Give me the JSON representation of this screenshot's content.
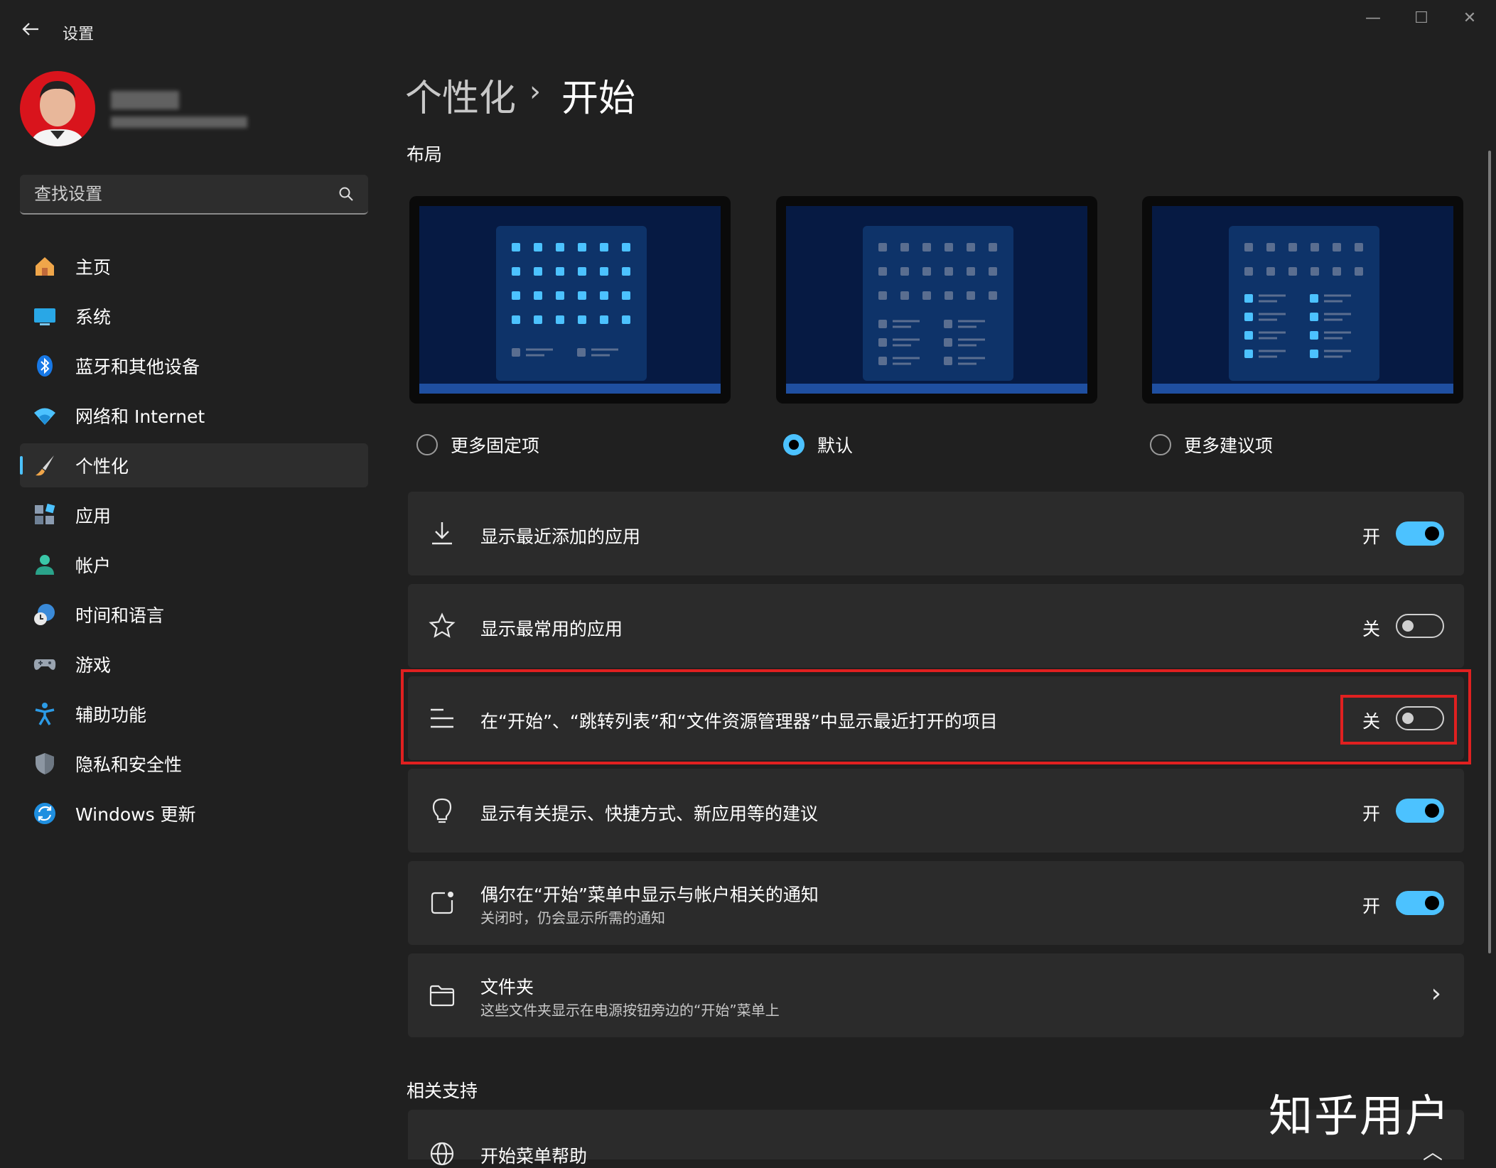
{
  "window": {
    "title": "设置",
    "controls": {
      "minimize": "—",
      "maximize": "☐",
      "close": "✕"
    }
  },
  "search": {
    "placeholder": "查找设置"
  },
  "sidebar": {
    "items": [
      {
        "label": "主页",
        "icon": "home-icon"
      },
      {
        "label": "系统",
        "icon": "system-icon"
      },
      {
        "label": "蓝牙和其他设备",
        "icon": "bluetooth-icon"
      },
      {
        "label": "网络和 Internet",
        "icon": "wifi-icon"
      },
      {
        "label": "个性化",
        "icon": "brush-icon",
        "active": true
      },
      {
        "label": "应用",
        "icon": "apps-icon"
      },
      {
        "label": "帐户",
        "icon": "account-icon"
      },
      {
        "label": "时间和语言",
        "icon": "globe-clock-icon"
      },
      {
        "label": "游戏",
        "icon": "gamepad-icon"
      },
      {
        "label": "辅助功能",
        "icon": "accessibility-icon"
      },
      {
        "label": "隐私和安全性",
        "icon": "shield-icon"
      },
      {
        "label": "Windows 更新",
        "icon": "update-icon"
      }
    ]
  },
  "breadcrumb": {
    "parent": "个性化",
    "separator": "›",
    "current": "开始"
  },
  "layout_section": {
    "title": "布局",
    "options": [
      {
        "label": "更多固定项",
        "selected": false
      },
      {
        "label": "默认",
        "selected": true
      },
      {
        "label": "更多建议项",
        "selected": false
      }
    ]
  },
  "settings": [
    {
      "title": "显示最近添加的应用",
      "state_label": "开",
      "on": true,
      "icon": "download-icon"
    },
    {
      "title": "显示最常用的应用",
      "state_label": "关",
      "on": false,
      "icon": "star-icon"
    },
    {
      "title": "在“开始”、“跳转列表”和“文件资源管理器”中显示最近打开的项目",
      "state_label": "关",
      "on": false,
      "icon": "list-icon"
    },
    {
      "title": "显示有关提示、快捷方式、新应用等的建议",
      "state_label": "开",
      "on": true,
      "icon": "lightbulb-icon"
    },
    {
      "title": "偶尔在“开始”菜单中显示与帐户相关的通知",
      "subtitle": "关闭时，仍会显示所需的通知",
      "state_label": "开",
      "on": true,
      "icon": "notification-icon"
    },
    {
      "title": "文件夹",
      "subtitle": "这些文件夹显示在电源按钮旁边的“开始”菜单上",
      "icon": "folder-icon",
      "chevron": "›"
    }
  ],
  "related_support": {
    "title": "相关支持",
    "items": [
      {
        "title": "开始菜单帮助",
        "icon": "globe-icon",
        "chevron": "︿"
      }
    ]
  },
  "watermark": "知乎用户",
  "colors": {
    "accent": "#4cc2ff",
    "highlight": "#e02020",
    "background": "#202020",
    "card": "#2b2b2b"
  }
}
